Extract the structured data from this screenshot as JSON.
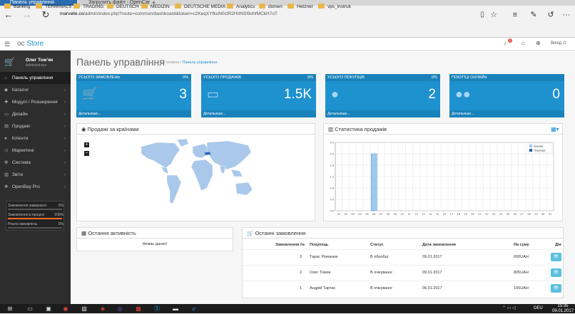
{
  "browser": {
    "tabs": [
      {
        "label": "Панель управління",
        "active": true
      },
      {
        "label": "Загрузить файл - OpenCart",
        "active": false
      }
    ],
    "new_tab": "+",
    "url_domain": "marvelle.co",
    "url_path": "/admin/index.php?route=common/dashboard&token=c2KeqXYfkuN0cIR2H0NSI9ohfMCkH7oT",
    "bookmarks": [
      "Banking",
      "TERMINALS",
      "TRADING",
      "DEUTSCH",
      "MEDIZIN",
      "DEUTSCHE MEDIA",
      "Analytics",
      "domen",
      "Hetzner",
      "vps_instruk"
    ]
  },
  "header": {
    "logo_prefix": "oc",
    "logo_name": "Store",
    "notification_count": "2",
    "logout_label": "Вихід"
  },
  "user": {
    "name": "Олег Томʼяк",
    "role": "Administrator"
  },
  "sidebar": {
    "items": [
      {
        "label": "Панель управління",
        "icon": "home-icon",
        "glyph": "⌂",
        "active": true,
        "chevron": false
      },
      {
        "label": "Каталог",
        "icon": "tag-icon",
        "glyph": "◆",
        "active": false,
        "chevron": true
      },
      {
        "label": "Модулі / Розширення",
        "icon": "puzzle-icon",
        "glyph": "✚",
        "active": false,
        "chevron": true
      },
      {
        "label": "Дизайн",
        "icon": "monitor-icon",
        "glyph": "▭",
        "active": false,
        "chevron": true
      },
      {
        "label": "Продажі",
        "icon": "cart-icon",
        "glyph": "▤",
        "active": false,
        "chevron": true
      },
      {
        "label": "Клієнти",
        "icon": "user-icon",
        "glyph": "●",
        "active": false,
        "chevron": true
      },
      {
        "label": "Маркетинг",
        "icon": "share-icon",
        "glyph": "◁",
        "active": false,
        "chevron": true
      },
      {
        "label": "Система",
        "icon": "gear-icon",
        "glyph": "✻",
        "active": false,
        "chevron": true
      },
      {
        "label": "Звіти",
        "icon": "chart-icon",
        "glyph": "▥",
        "active": false,
        "chevron": true
      },
      {
        "label": "OpenBay Pro",
        "icon": "bay-icon",
        "glyph": "✥",
        "active": false,
        "chevron": true
      }
    ],
    "progress": [
      {
        "label": "Замовлення завершені",
        "value": "0%",
        "fraction": 0,
        "color": "#f0ad4e"
      },
      {
        "label": "Замовлення в процесі",
        "value": "100%",
        "fraction": 1,
        "color": "#f56b2a"
      },
      {
        "label": "Решта замовлень",
        "value": "0%",
        "fraction": 0,
        "color": "#5cb85c"
      }
    ]
  },
  "page": {
    "title": "Панель управління",
    "breadcrumb_home": "Головна",
    "breadcrumb_current": "Панель управління"
  },
  "tiles": [
    {
      "label": "УСЬОГО ЗАМОВЛЕНЬ",
      "pct": "0%",
      "value": "3",
      "footer": "Детальніше...",
      "icon": "cart-icon",
      "glyph": "🛒"
    },
    {
      "label": "УСЬОГО ПРОДАЖІВ",
      "pct": "0%",
      "value": "1.5K",
      "footer": "Детальніше...",
      "icon": "credit-card-icon",
      "glyph": "▭"
    },
    {
      "label": "УСЬОГО ПОКУПЦІВ",
      "pct": "0%",
      "value": "2",
      "footer": "Детальніше...",
      "icon": "user-icon",
      "glyph": "●"
    },
    {
      "label": "ПОКУПЦІ ОНЛАЙН",
      "pct": "",
      "value": "0",
      "footer": "Детальніше...",
      "icon": "users-icon",
      "glyph": "●●"
    }
  ],
  "map_panel": {
    "title": "Продажі за країнами",
    "zoom_in": "+",
    "zoom_out": "−"
  },
  "sales_panel": {
    "title": "Статистика продажів"
  },
  "chart_data": {
    "type": "bar",
    "categories": [
      "01",
      "02",
      "03",
      "04",
      "05",
      "06",
      "07",
      "08",
      "09",
      "10",
      "11",
      "12",
      "13",
      "14",
      "15",
      "16",
      "17",
      "18",
      "19",
      "20",
      "21",
      "22",
      "23",
      "24",
      "25",
      "26",
      "27",
      "28",
      "29",
      "30",
      "31"
    ],
    "series": [
      {
        "name": "Заказы",
        "color": "#9ec9ee",
        "values": [
          0,
          0,
          0,
          0,
          0,
          2,
          0,
          0,
          0,
          0,
          0,
          0,
          0,
          0,
          0,
          0,
          0,
          0,
          0,
          0,
          0,
          0,
          0,
          0,
          0,
          0,
          0,
          0,
          0,
          0,
          0
        ]
      },
      {
        "name": "Покупців",
        "color": "#1a5fa0",
        "values": [
          0,
          0,
          0,
          0,
          0,
          0,
          0,
          0,
          0,
          0,
          0,
          0,
          0,
          0,
          0,
          0,
          0,
          0,
          0,
          0,
          0,
          0,
          0,
          0,
          0,
          0,
          0,
          0,
          0,
          0,
          0
        ]
      }
    ],
    "yticks": [
      "0.0",
      "0.4",
      "0.8",
      "1.2",
      "1.6",
      "2.0",
      "2.4"
    ],
    "ylim": [
      0,
      2.4
    ],
    "grid": true,
    "legend": "top-right"
  },
  "activity": {
    "title": "Остання активність",
    "empty": "Немає даних!"
  },
  "orders": {
    "title": "Останні замовлення",
    "columns": [
      "Замовлення №",
      "Покупець",
      "Статус",
      "Дата замовлення",
      "На суму",
      "Дія"
    ],
    "rows": [
      {
        "id": "3",
        "customer": "Тарас Романюк",
        "status": "В обробці",
        "date": "09.01.2017",
        "total": "600UAH"
      },
      {
        "id": "2",
        "customer": "Олег Томяк",
        "status": "В очікуванні",
        "date": "09.01.2017",
        "total": "805UAH"
      },
      {
        "id": "1",
        "customer": "Андрій Тартак",
        "status": "В очікуванні",
        "date": "06.01.2017",
        "total": "105UAH"
      }
    ]
  },
  "taskbar": {
    "lang": "DEU",
    "time": "15:35",
    "date": "09.01.2017"
  }
}
